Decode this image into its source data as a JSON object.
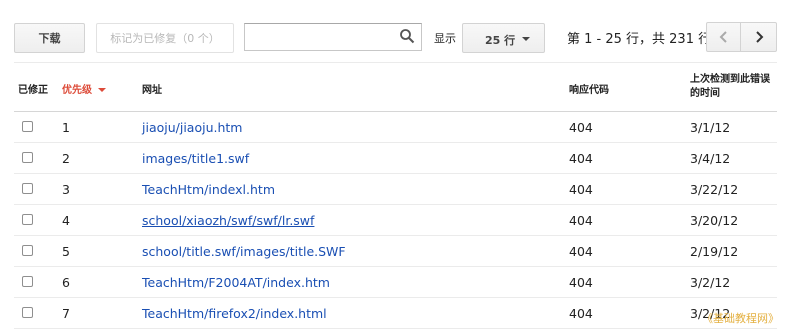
{
  "toolbar": {
    "download_label": "下载",
    "mark_fixed_label": "标记为已修复（0 个）",
    "search_placeholder": "",
    "search_icon": "magnifier-icon",
    "show_label": "显示",
    "rows_select_value": "25 行",
    "pagination_text": "第 1 - 25 行，共 231 行",
    "prev_icon": "chevron-left-icon",
    "next_icon": "chevron-right-icon"
  },
  "table": {
    "headers": {
      "fixed": "已修正",
      "priority": "优先级",
      "url": "网址",
      "response_code": "响应代码",
      "last_detected": "上次检测到此错误的时间"
    },
    "rows": [
      {
        "priority": "1",
        "url": "jiaoju/jiaoju.htm",
        "code": "404",
        "date": "3/1/12",
        "underlined": false
      },
      {
        "priority": "2",
        "url": "images/title1.swf",
        "code": "404",
        "date": "3/4/12",
        "underlined": false
      },
      {
        "priority": "3",
        "url": "TeachHtm/indexl.htm",
        "code": "404",
        "date": "3/22/12",
        "underlined": false
      },
      {
        "priority": "4",
        "url": "school/xiaozh/swf/swf/lr.swf",
        "code": "404",
        "date": "3/20/12",
        "underlined": true
      },
      {
        "priority": "5",
        "url": "school/title.swf/images/title.SWF",
        "code": "404",
        "date": "2/19/12",
        "underlined": false
      },
      {
        "priority": "6",
        "url": "TeachHtm/F2004AT/index.htm",
        "code": "404",
        "date": "3/2/12",
        "underlined": false
      },
      {
        "priority": "7",
        "url": "TeachHtm/firefox2/index.html",
        "code": "404",
        "date": "3/2/12",
        "underlined": false
      }
    ]
  },
  "watermark": "《基础教程网》",
  "colors": {
    "link": "#1a4fb3",
    "sort_active": "#dd4b39",
    "watermark": "#e4b040"
  }
}
